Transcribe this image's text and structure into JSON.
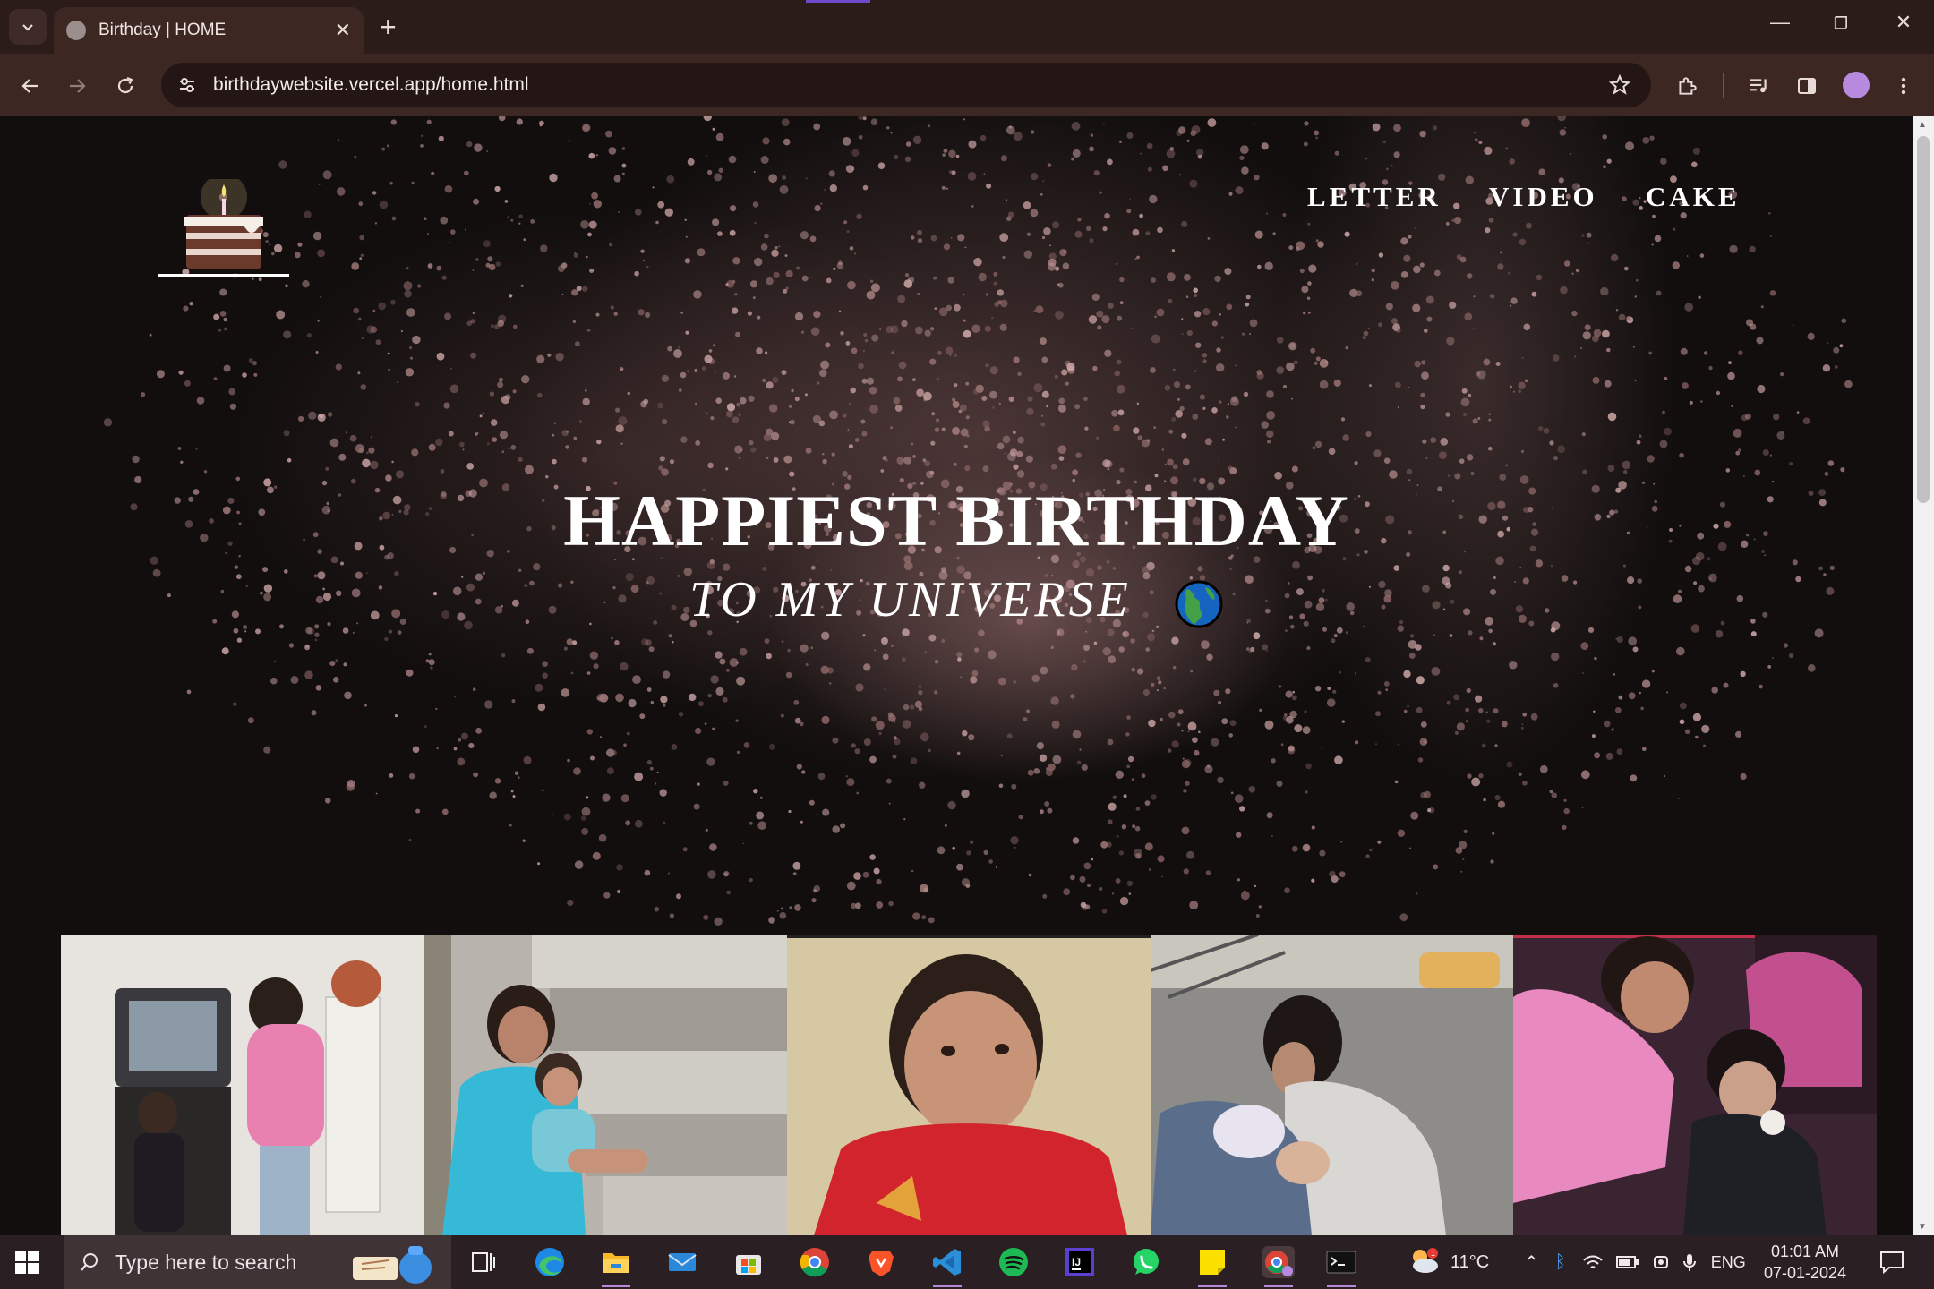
{
  "browser": {
    "tab_title": "Birthday | HOME",
    "url": "birthdaywebsite.vercel.app/home.html"
  },
  "site": {
    "nav": [
      "LETTER",
      "VIDEO",
      "CAKE"
    ],
    "hero_title": "HAPPIEST BIRTHDAY",
    "hero_subtitle": "TO MY UNIVERSE"
  },
  "taskbar": {
    "search_placeholder": "Type here to search",
    "weather": "11°C",
    "language": "ENG",
    "time": "01:01 AM",
    "date": "07-01-2024",
    "pinned_apps": [
      "task-view",
      "edge",
      "file-explorer",
      "mail",
      "store",
      "chrome",
      "brave",
      "vscode",
      "spotify",
      "intellij",
      "whatsapp",
      "sticky-notes",
      "chrome-profile",
      "terminal"
    ]
  },
  "colors": {
    "chrome_frame": "#2b1c1a",
    "toolbar": "#3d2723",
    "page_bg": "#120e0e",
    "taskbar": "#2a1f22"
  }
}
